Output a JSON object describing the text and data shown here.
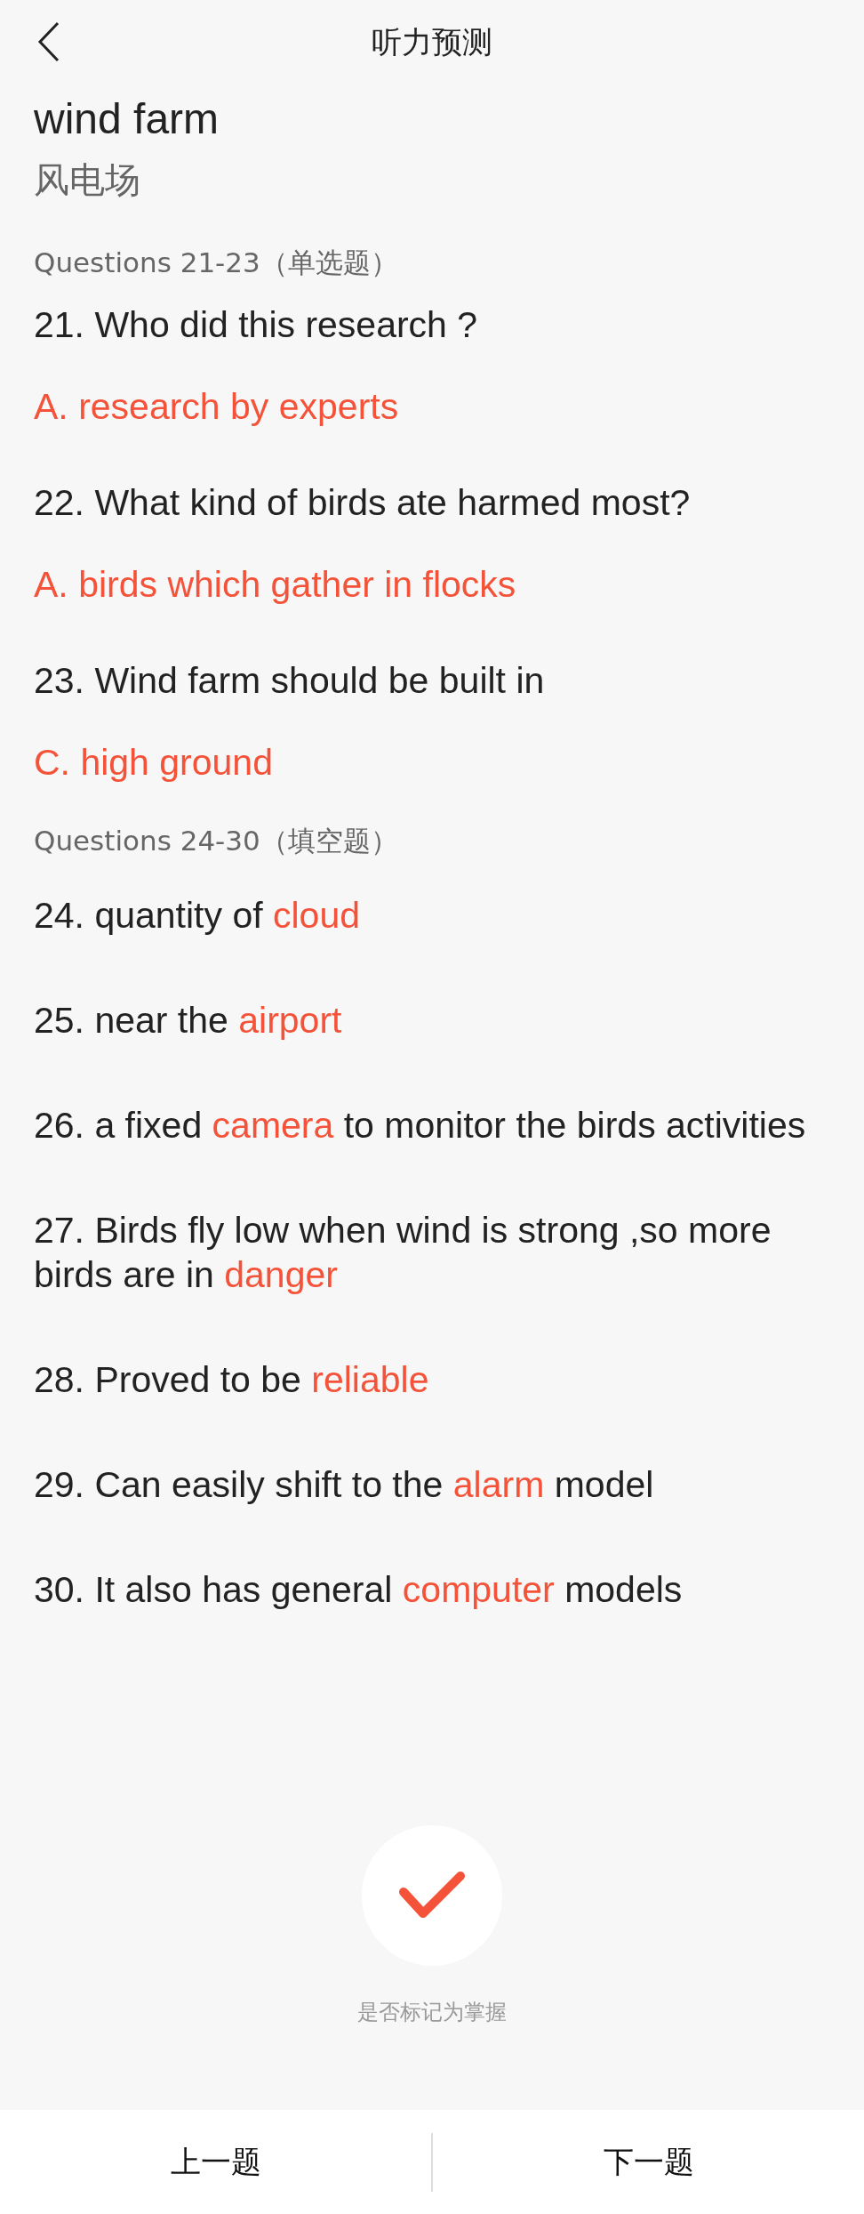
{
  "header": {
    "title": "听力预测"
  },
  "topic": {
    "title": "wind farm",
    "translation": "风电场"
  },
  "sections": [
    {
      "kind": "choice",
      "heading": "Questions 21-23（单选题）",
      "items": [
        {
          "question": "21. Who did this research ?",
          "answer": "A. research by experts"
        },
        {
          "question": "22. What kind of birds ate harmed most?",
          "answer": "A. birds which gather in flocks"
        },
        {
          "question": "23. Wind farm should be built in",
          "answer": "C. high ground"
        }
      ]
    },
    {
      "kind": "blank",
      "heading": "Questions 24-30（填空题）",
      "items": [
        {
          "before": "24. quantity of ",
          "answer": "cloud"
        },
        {
          "before": "25. near the ",
          "answer": "airport"
        },
        {
          "before": "26. a fixed ",
          "answer": "camera",
          "after": " to monitor the birds activities"
        },
        {
          "before": "27. Birds fly low when wind is strong ,so more birds are in ",
          "answer": "danger"
        },
        {
          "before": "28. Proved to be ",
          "answer": "reliable"
        },
        {
          "before": "29. Can easily shift to the ",
          "answer": "alarm",
          "after": " model"
        },
        {
          "before": "30. It also has general ",
          "answer": "computer",
          "after": " models"
        }
      ]
    }
  ],
  "mastered": {
    "label": "是否标记为掌握",
    "checked": true
  },
  "footer": {
    "prev": "上一题",
    "next": "下一题"
  }
}
